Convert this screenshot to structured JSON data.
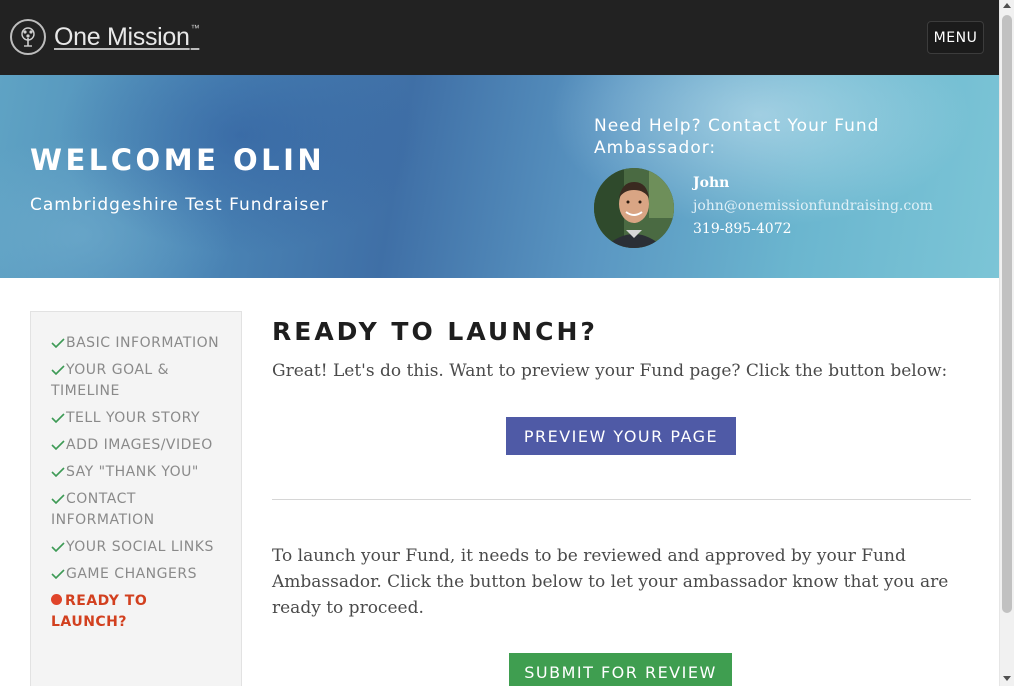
{
  "header": {
    "logo_text": "One Mission",
    "logo_tm": "™",
    "menu_label": "MENU"
  },
  "hero": {
    "welcome": "WELCOME OLIN",
    "subtitle": "Cambridgeshire Test Fundraiser",
    "help_title": "Need Help? Contact Your Fund Ambassador:",
    "ambassador": {
      "name": "John",
      "email": "john@onemissionfundraising.com",
      "phone": "319-895-4072"
    }
  },
  "sidebar": {
    "steps": [
      {
        "label": "BASIC INFORMATION",
        "status": "complete"
      },
      {
        "label": "YOUR GOAL & TIMELINE",
        "status": "complete"
      },
      {
        "label": "TELL YOUR STORY",
        "status": "complete"
      },
      {
        "label": "ADD IMAGES/VIDEO",
        "status": "complete"
      },
      {
        "label": "SAY \"THANK YOU\"",
        "status": "complete"
      },
      {
        "label": "CONTACT INFORMATION",
        "status": "complete"
      },
      {
        "label": "YOUR SOCIAL LINKS",
        "status": "complete"
      },
      {
        "label": "GAME CHANGERS",
        "status": "complete"
      },
      {
        "label": "READY TO LAUNCH?",
        "status": "active"
      }
    ]
  },
  "main": {
    "title": "READY TO LAUNCH?",
    "intro": "Great! Let's do this. Want to preview your Fund page? Click the button below:",
    "preview_button": "PREVIEW YOUR PAGE",
    "launch_text": "To launch your Fund, it needs to be reviewed and approved by your Fund Ambassador. Click the button below to let your ambassador know that you are ready to proceed.",
    "submit_button": "SUBMIT FOR REVIEW"
  },
  "colors": {
    "topbar": "#222222",
    "preview_button": "#4f5aa6",
    "submit_button": "#3f9e50",
    "check_green": "#3d9a55",
    "active_step": "#d2401f"
  },
  "icons": {
    "step_complete": "check-icon",
    "step_active": "dot-icon",
    "logo": "tree-icon"
  }
}
